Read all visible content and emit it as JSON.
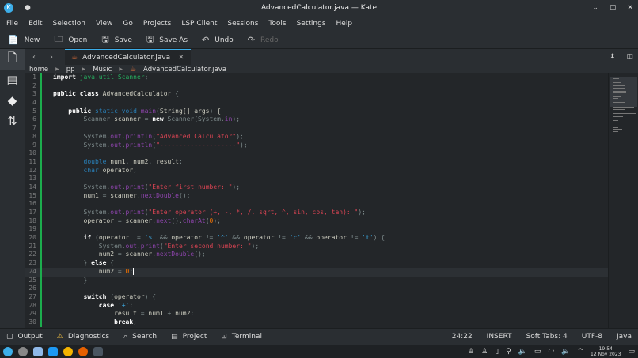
{
  "window": {
    "title": "AdvancedCalculator.java — Kate",
    "app_icon": "K",
    "modified_dot": "●",
    "controls": [
      "⌄",
      "▢",
      "✕"
    ]
  },
  "menu": [
    "File",
    "Edit",
    "Selection",
    "View",
    "Go",
    "Projects",
    "LSP Client",
    "Sessions",
    "Tools",
    "Settings",
    "Help"
  ],
  "toolbar": [
    {
      "icon": "📄",
      "label": "New"
    },
    {
      "icon": "🗀",
      "label": "Open"
    },
    {
      "icon": "🖫",
      "label": "Save"
    },
    {
      "icon": "🖫",
      "label": "Save As"
    },
    {
      "icon": "↶",
      "label": "Undo"
    },
    {
      "icon": "↷",
      "label": "Redo",
      "disabled": true
    }
  ],
  "tab": {
    "label": "AdvancedCalculator.java",
    "close": "✕"
  },
  "breadcrumb": [
    "home",
    "pp",
    "Music",
    "AdvancedCalculator.java"
  ],
  "code": [
    [
      [
        "kw",
        "import "
      ],
      [
        "pkg",
        "java.util.Scanner"
      ],
      [
        "op",
        ";"
      ]
    ],
    [],
    [
      [
        "kw",
        "public class "
      ],
      [
        "",
        "AdvancedCalculator "
      ],
      [
        "op",
        "{"
      ]
    ],
    [],
    [
      [
        "",
        "    "
      ],
      [
        "kw",
        "public "
      ],
      [
        "ty",
        "static void "
      ],
      [
        "fn",
        "main"
      ],
      [
        "op",
        "("
      ],
      [
        "",
        "String[] args"
      ],
      [
        "op",
        ") "
      ],
      [
        "",
        "{"
      ]
    ],
    [
      [
        "",
        "        "
      ],
      [
        "op",
        "Scanner "
      ],
      [
        "",
        "scanner "
      ],
      [
        "op",
        "= "
      ],
      [
        "kw",
        "new "
      ],
      [
        "op",
        "Scanner(System."
      ],
      [
        "fn",
        "in"
      ],
      [
        "op",
        ");"
      ]
    ],
    [],
    [
      [
        "",
        "        "
      ],
      [
        "op",
        "System."
      ],
      [
        "fn",
        "out"
      ],
      [
        "op",
        "."
      ],
      [
        "fn",
        "println"
      ],
      [
        "op",
        "("
      ],
      [
        "str",
        "\"Advanced Calculator\""
      ],
      [
        "op",
        ");"
      ]
    ],
    [
      [
        "",
        "        "
      ],
      [
        "op",
        "System."
      ],
      [
        "fn",
        "out"
      ],
      [
        "op",
        "."
      ],
      [
        "fn",
        "println"
      ],
      [
        "op",
        "("
      ],
      [
        "str",
        "\"--------------------\""
      ],
      [
        "op",
        ");"
      ]
    ],
    [],
    [
      [
        "",
        "        "
      ],
      [
        "ty",
        "double "
      ],
      [
        "",
        "num1"
      ],
      [
        "op",
        ", "
      ],
      [
        "",
        "num2"
      ],
      [
        "op",
        ", "
      ],
      [
        "",
        "result"
      ],
      [
        "op",
        ";"
      ]
    ],
    [
      [
        "",
        "        "
      ],
      [
        "ty",
        "char "
      ],
      [
        "",
        "operator"
      ],
      [
        "op",
        ";"
      ]
    ],
    [],
    [
      [
        "",
        "        "
      ],
      [
        "op",
        "System."
      ],
      [
        "fn",
        "out"
      ],
      [
        "op",
        "."
      ],
      [
        "fn",
        "print"
      ],
      [
        "op",
        "("
      ],
      [
        "str",
        "\"Enter first number: \""
      ],
      [
        "op",
        ");"
      ]
    ],
    [
      [
        "",
        "        "
      ],
      [
        "",
        "num1 "
      ],
      [
        "op",
        "= "
      ],
      [
        "",
        "scanner"
      ],
      [
        "op",
        "."
      ],
      [
        "fn",
        "nextDouble"
      ],
      [
        "op",
        "();"
      ]
    ],
    [],
    [
      [
        "",
        "        "
      ],
      [
        "op",
        "System."
      ],
      [
        "fn",
        "out"
      ],
      [
        "op",
        "."
      ],
      [
        "fn",
        "print"
      ],
      [
        "op",
        "("
      ],
      [
        "str",
        "\"Enter operator (+, -, *, /, sqrt, ^, sin, cos, tan): \""
      ],
      [
        "op",
        ");"
      ]
    ],
    [
      [
        "",
        "        "
      ],
      [
        "",
        "operator "
      ],
      [
        "op",
        "= "
      ],
      [
        "",
        "scanner"
      ],
      [
        "op",
        "."
      ],
      [
        "fn",
        "next"
      ],
      [
        "op",
        "()."
      ],
      [
        "fn",
        "charAt"
      ],
      [
        "op",
        "("
      ],
      [
        "num",
        "0"
      ],
      [
        "op",
        ");"
      ]
    ],
    [],
    [
      [
        "",
        "        "
      ],
      [
        "kw",
        "if "
      ],
      [
        "op",
        "("
      ],
      [
        "",
        "operator "
      ],
      [
        "op",
        "!= "
      ],
      [
        "ch",
        "'s' "
      ],
      [
        "op",
        "&& "
      ],
      [
        "",
        "operator "
      ],
      [
        "op",
        "!= "
      ],
      [
        "ch",
        "'^' "
      ],
      [
        "op",
        "&& "
      ],
      [
        "",
        "operator "
      ],
      [
        "op",
        "!= "
      ],
      [
        "ch",
        "'c' "
      ],
      [
        "op",
        "&& "
      ],
      [
        "",
        "operator "
      ],
      [
        "op",
        "!= "
      ],
      [
        "ch",
        "'t'"
      ],
      [
        "op",
        ") {"
      ]
    ],
    [
      [
        "",
        "            "
      ],
      [
        "op",
        "System."
      ],
      [
        "fn",
        "out"
      ],
      [
        "op",
        "."
      ],
      [
        "fn",
        "print"
      ],
      [
        "op",
        "("
      ],
      [
        "str",
        "\"Enter second number: \""
      ],
      [
        "op",
        ");"
      ]
    ],
    [
      [
        "",
        "            "
      ],
      [
        "",
        "num2 "
      ],
      [
        "op",
        "= "
      ],
      [
        "",
        "scanner"
      ],
      [
        "op",
        "."
      ],
      [
        "fn",
        "nextDouble"
      ],
      [
        "op",
        "();"
      ]
    ],
    [
      [
        "",
        "        "
      ],
      [
        "op",
        "} "
      ],
      [
        "kw",
        "else "
      ],
      [
        "op",
        "{"
      ]
    ],
    [
      [
        "",
        "            "
      ],
      [
        "",
        "num2 "
      ],
      [
        "op",
        "= "
      ],
      [
        "num",
        "0"
      ],
      [
        "op",
        ";"
      ]
    ],
    [
      [
        "",
        "        "
      ],
      [
        "op",
        "}"
      ]
    ],
    [],
    [
      [
        "",
        "        "
      ],
      [
        "kw",
        "switch "
      ],
      [
        "op",
        "("
      ],
      [
        "",
        "operator"
      ],
      [
        "op",
        ") {"
      ]
    ],
    [
      [
        "",
        "            "
      ],
      [
        "kw",
        "case "
      ],
      [
        "ch",
        "'+'"
      ],
      [
        "op",
        ":"
      ]
    ],
    [
      [
        "",
        "                "
      ],
      [
        "",
        "result "
      ],
      [
        "op",
        "= "
      ],
      [
        "",
        "num1 "
      ],
      [
        "op",
        "+ "
      ],
      [
        "",
        "num2"
      ],
      [
        "op",
        ";"
      ]
    ],
    [
      [
        "",
        "                "
      ],
      [
        "kw",
        "break"
      ],
      [
        "op",
        ";"
      ]
    ]
  ],
  "cursor_line": 24,
  "bottom_tabs": [
    {
      "icon": "▢",
      "label": "Output"
    },
    {
      "icon": "⚠",
      "label": "Diagnostics"
    },
    {
      "icon": "⌕",
      "label": "Search"
    },
    {
      "icon": "▤",
      "label": "Project"
    },
    {
      "icon": "⊡",
      "label": "Terminal"
    }
  ],
  "status": {
    "position": "24:22",
    "mode": "INSERT",
    "indent": "Soft Tabs: 4",
    "encoding": "UTF-8",
    "language": "Java"
  },
  "taskbar": {
    "time": "19:54",
    "date": "12 Nov 2023",
    "tray_icons": [
      "♙",
      "♙",
      "▯",
      "⚲",
      "🔈",
      "▭",
      "◠",
      "🔈",
      "^"
    ]
  }
}
